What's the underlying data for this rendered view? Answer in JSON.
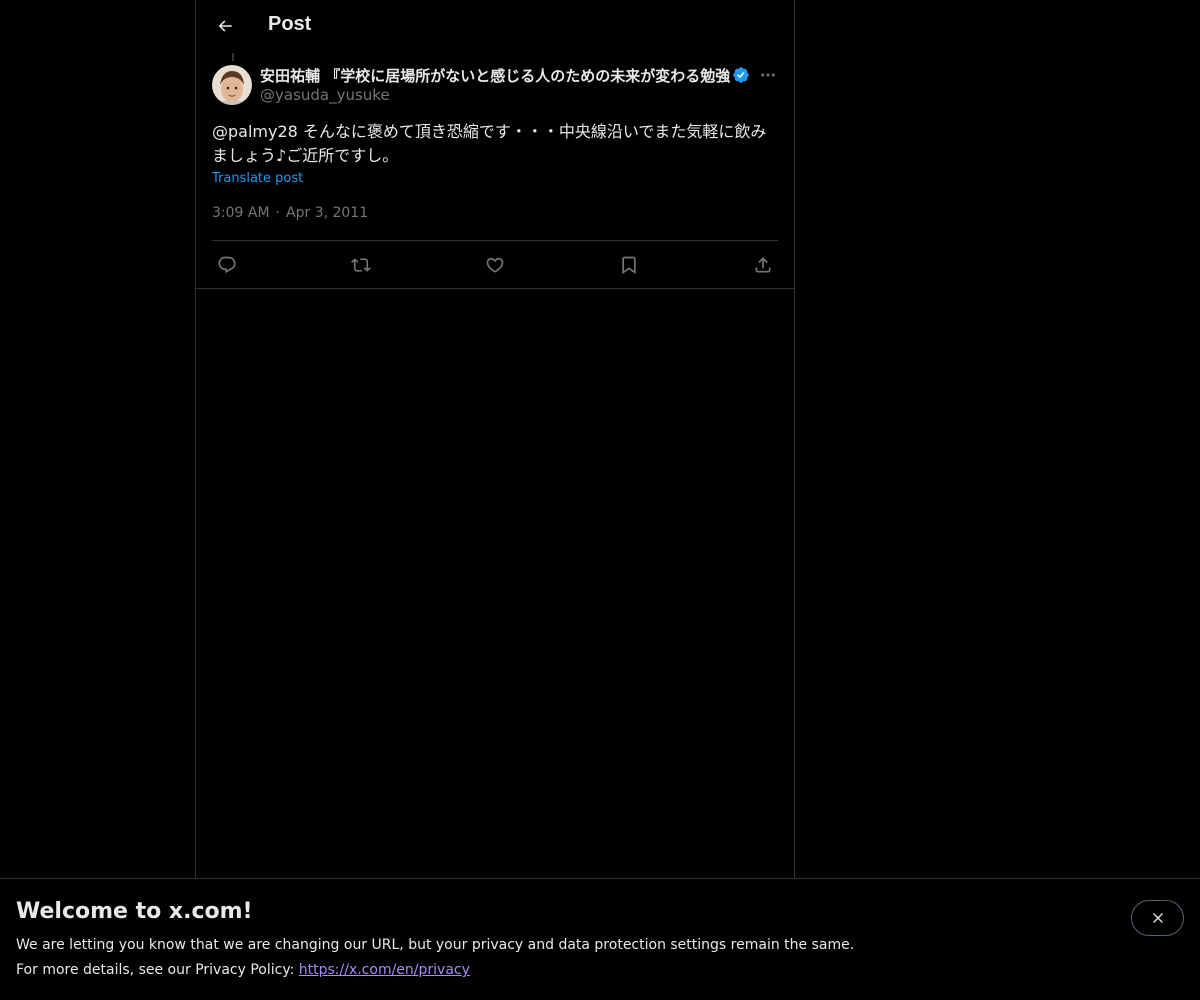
{
  "header": {
    "title": "Post",
    "back_icon": "arrow-left-icon"
  },
  "post": {
    "display_name": "安田祐輔 『学校に居場所がないと感じる人のための未来が変わる勉強法』",
    "verified": true,
    "handle": "@yasuda_yusuke",
    "text": "@palmy28 そんなに褒めて頂き恐縮です・・・中央線沿いでまた気軽に飲みましょう♪ご近所ですし。",
    "translate_label": "Translate post",
    "time": "3:09 AM",
    "separator": "·",
    "date": "Apr 3, 2011",
    "actions": [
      "reply-icon",
      "repost-icon",
      "like-icon",
      "bookmark-icon",
      "share-icon"
    ]
  },
  "banner": {
    "title": "Welcome to x.com!",
    "line1": "We are letting you know that we are changing our URL, but your privacy and data protection settings remain the same.",
    "line2_prefix": "For more details, see our Privacy Policy: ",
    "link": "https://x.com/en/privacy"
  },
  "colors": {
    "background": "#000000",
    "text": "#e7e9ea",
    "muted": "#71767b",
    "accent": "#1d9bf0",
    "border": "#2f3336"
  }
}
